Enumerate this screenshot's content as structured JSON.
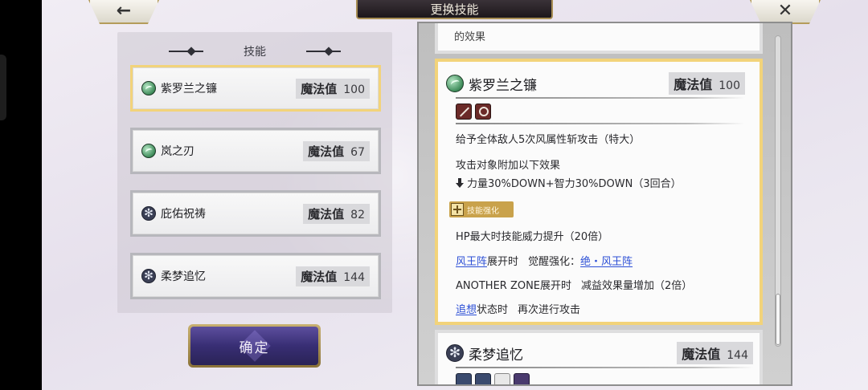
{
  "header": {
    "title": "更换技能",
    "back_icon": "←",
    "close_icon": "✕"
  },
  "skill_panel": {
    "title": "技能",
    "items": [
      {
        "name": "紫罗兰之镰",
        "mp_label": "魔法值",
        "mp": "100",
        "icon": "wind-icon",
        "selected": true
      },
      {
        "name": "岚之刃",
        "mp_label": "魔法值",
        "mp": "67",
        "icon": "wind-icon",
        "selected": false
      },
      {
        "name": "庇佑祝祷",
        "mp_label": "魔法值",
        "mp": "82",
        "icon": "gear-icon",
        "selected": false
      },
      {
        "name": "柔梦追忆",
        "mp_label": "魔法值",
        "mp": "144",
        "icon": "gear-icon",
        "selected": false
      }
    ]
  },
  "confirm_label": "确定",
  "details": {
    "previous_tail": "的效果",
    "current": {
      "name": "紫罗兰之镰",
      "mp_label": "魔法值",
      "mp": "100",
      "tags": [
        "sword-tag-icon",
        "search-tag-icon"
      ],
      "lines": {
        "l1": "给予全体敌人5次风属性斩攻击（特大）",
        "l2": "攻击对象附加以下效果",
        "l3": "力量30%DOWN+智力30%DOWN（3回合）",
        "badge": "技能强化",
        "l4": "HP最大时技能威力提升（20倍）",
        "l5_link": "风王阵",
        "l5_text": "展开时",
        "l5_label": "觉醒强化：",
        "l5_link2": "绝・风王阵",
        "l6_a": "ANOTHER ZONE展开时",
        "l6_b": "减益效果量增加（2倍）",
        "l7_link": "追想",
        "l7_a": "状态时",
        "l7_b": "再次进行攻击"
      }
    },
    "next": {
      "name": "柔梦追忆",
      "mp_label": "魔法值",
      "mp": "144"
    }
  },
  "colors": {
    "selected_border": "#f2d37a",
    "link": "#2c4fd6",
    "confirm_bg": "#382e74",
    "title_bar": "#1c171b"
  }
}
